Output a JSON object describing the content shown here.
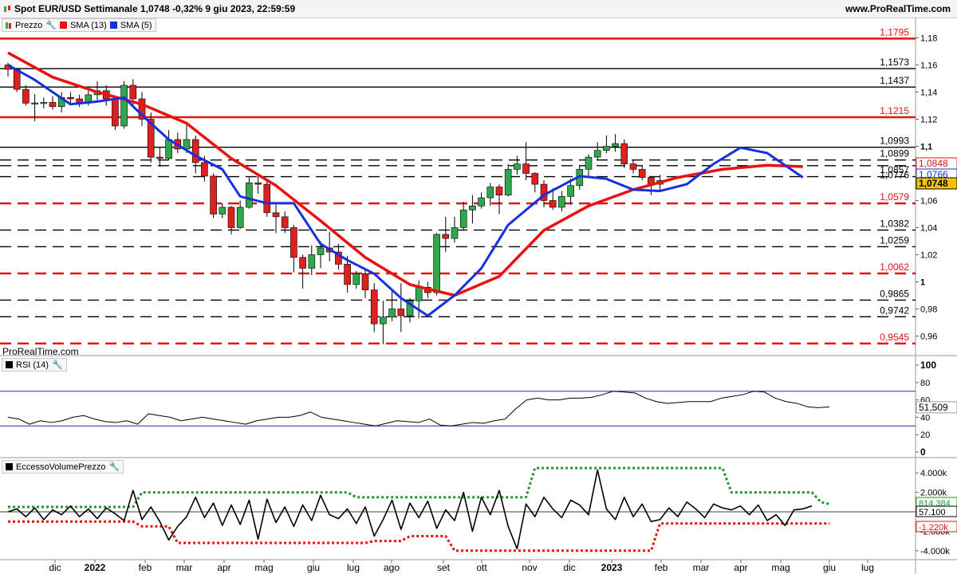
{
  "header": {
    "title": "Spot EUR/USD Settimanale 1,0748 -0,32% 9 giu 2023, 22:59:59",
    "site": "www.ProRealTime.com"
  },
  "watermark": "ProRealTime.com",
  "legend": {
    "price": "Prezzo",
    "sma13": "SMA (13)",
    "sma5": "SMA (5)",
    "rsi": "RSI (14)",
    "volume": "EccessoVolumePrezzo"
  },
  "colors": {
    "up": "#2ea84a",
    "down": "#e0201f",
    "sma13": "#e8120f",
    "sma5": "#1530e0",
    "levelRed": "#e8120f",
    "vpUpper": "#1f9a2a",
    "vpLower": "#e8120f"
  },
  "chart_data": [
    {
      "type": "candlestick",
      "x_labels": [
        "dic",
        "2022",
        "feb",
        "mar",
        "apr",
        "mag",
        "giu",
        "lug",
        "ago",
        "set",
        "ott",
        "nov",
        "dic",
        "2023",
        "feb",
        "mar",
        "apr",
        "mag",
        "giu",
        "lug"
      ],
      "ylim": [
        0.95,
        1.18
      ],
      "y_ticks": [
        "1,18",
        "1,16",
        "1,14",
        "1,12",
        "1,1",
        "1,08",
        "1,06",
        "1,04",
        "1,02",
        "1",
        "0,98",
        "0,96"
      ],
      "levels": [
        {
          "value": 1.1795,
          "label": "1,1795",
          "color": "red",
          "style": "solid"
        },
        {
          "value": 1.1573,
          "label": "1,1573",
          "color": "black",
          "style": "solid"
        },
        {
          "value": 1.1437,
          "label": "1,1437",
          "color": "black",
          "style": "solid"
        },
        {
          "value": 1.1215,
          "label": "1,1215",
          "color": "red",
          "style": "solid"
        },
        {
          "value": 1.0993,
          "label": "1,0993",
          "color": "black",
          "style": "solid"
        },
        {
          "value": 1.0899,
          "label": "1,0899",
          "color": "black",
          "style": "dashed"
        },
        {
          "value": 1.0857,
          "label": "1,0857",
          "color": "black",
          "style": "dashed"
        },
        {
          "value": 1.0776,
          "label": "1,0776",
          "color": "black",
          "style": "dashed"
        },
        {
          "value": 1.0579,
          "label": "1,0579",
          "color": "red",
          "style": "dashed"
        },
        {
          "value": 1.0382,
          "label": "1,0382",
          "color": "black",
          "style": "dashed"
        },
        {
          "value": 1.0259,
          "label": "1,0259",
          "color": "black",
          "style": "dashed"
        },
        {
          "value": 1.0062,
          "label": "1,0062",
          "color": "red",
          "style": "dashed"
        },
        {
          "value": 0.9865,
          "label": "0,9865",
          "color": "black",
          "style": "dashed"
        },
        {
          "value": 0.9742,
          "label": "0,9742",
          "color": "black",
          "style": "dashed"
        },
        {
          "value": 0.9545,
          "label": "0,9545",
          "color": "red",
          "style": "dashed"
        }
      ],
      "price_tags": [
        {
          "value": 1.0848,
          "label": "1,0848",
          "color": "red"
        },
        {
          "value": 1.0766,
          "label": "1,0766",
          "color": "blue"
        },
        {
          "value": 1.0748,
          "label": "1,0748",
          "color": "gold"
        }
      ],
      "candles": [
        [
          1.16,
          1.1568,
          1.1617,
          1.1514
        ],
        [
          1.1568,
          1.142,
          1.1579,
          1.14
        ],
        [
          1.142,
          1.1318,
          1.145,
          1.13
        ],
        [
          1.1318,
          1.132,
          1.1385,
          1.1184
        ],
        [
          1.132,
          1.1324,
          1.136,
          1.128
        ],
        [
          1.1324,
          1.1293,
          1.137,
          1.127
        ],
        [
          1.1293,
          1.136,
          1.14,
          1.125
        ],
        [
          1.136,
          1.135,
          1.14,
          1.131
        ],
        [
          1.135,
          1.132,
          1.138,
          1.129
        ],
        [
          1.132,
          1.138,
          1.141,
          1.13
        ],
        [
          1.138,
          1.141,
          1.148,
          1.134
        ],
        [
          1.141,
          1.135,
          1.145,
          1.13
        ],
        [
          1.135,
          1.115,
          1.137,
          1.112
        ],
        [
          1.115,
          1.145,
          1.1482,
          1.113
        ],
        [
          1.145,
          1.135,
          1.1495,
          1.13
        ],
        [
          1.135,
          1.12,
          1.14,
          1.115
        ],
        [
          1.12,
          1.092,
          1.125,
          1.088
        ],
        [
          1.092,
          1.091,
          1.099,
          1.085
        ],
        [
          1.091,
          1.105,
          1.112,
          1.09
        ],
        [
          1.105,
          1.098,
          1.11,
          1.095
        ],
        [
          1.098,
          1.105,
          1.118,
          1.095
        ],
        [
          1.105,
          1.088,
          1.108,
          1.08
        ],
        [
          1.088,
          1.078,
          1.093,
          1.074
        ],
        [
          1.078,
          1.05,
          1.08,
          1.047
        ],
        [
          1.05,
          1.055,
          1.058,
          1.047
        ],
        [
          1.055,
          1.04,
          1.056,
          1.035
        ],
        [
          1.04,
          1.055,
          1.06,
          1.039
        ],
        [
          1.055,
          1.073,
          1.077,
          1.054
        ],
        [
          1.073,
          1.072,
          1.078,
          1.065
        ],
        [
          1.072,
          1.051,
          1.076,
          1.048
        ],
        [
          1.051,
          1.048,
          1.057,
          1.036
        ],
        [
          1.048,
          1.04,
          1.052,
          1.036
        ],
        [
          1.04,
          1.018,
          1.042,
          1.007
        ],
        [
          1.018,
          1.01,
          1.02,
          0.995
        ],
        [
          1.01,
          1.02,
          1.027,
          1.005
        ],
        [
          1.02,
          1.025,
          1.03,
          1.01
        ],
        [
          1.025,
          1.022,
          1.037,
          1.015
        ],
        [
          1.022,
          1.013,
          1.028,
          1.009
        ],
        [
          1.013,
          0.998,
          1.019,
          0.992
        ],
        [
          0.998,
          1.006,
          1.008,
          0.995
        ],
        [
          1.006,
          0.994,
          1.01,
          0.988
        ],
        [
          0.994,
          0.969,
          0.999,
          0.963
        ],
        [
          0.969,
          0.974,
          0.986,
          0.954
        ],
        [
          0.974,
          0.98,
          0.993,
          0.971
        ],
        [
          0.98,
          0.975,
          0.999,
          0.963
        ],
        [
          0.975,
          0.986,
          0.988,
          0.97
        ],
        [
          0.986,
          0.996,
          1.001,
          0.973
        ],
        [
          0.996,
          0.992,
          1.0,
          0.988
        ],
        [
          0.992,
          1.035,
          1.036,
          0.99
        ],
        [
          1.035,
          1.032,
          1.048,
          1.022
        ],
        [
          1.032,
          1.04,
          1.048,
          1.029
        ],
        [
          1.04,
          1.053,
          1.059,
          1.038
        ],
        [
          1.053,
          1.056,
          1.064,
          1.043
        ],
        [
          1.056,
          1.062,
          1.066,
          1.054
        ],
        [
          1.062,
          1.07,
          1.073,
          1.056
        ],
        [
          1.07,
          1.064,
          1.072,
          1.05
        ],
        [
          1.064,
          1.083,
          1.087,
          1.063
        ],
        [
          1.083,
          1.087,
          1.093,
          1.079
        ],
        [
          1.087,
          1.08,
          1.103,
          1.075
        ],
        [
          1.08,
          1.072,
          1.081,
          1.066
        ],
        [
          1.072,
          1.06,
          1.075,
          1.055
        ],
        [
          1.06,
          1.055,
          1.069,
          1.053
        ],
        [
          1.055,
          1.063,
          1.067,
          1.052
        ],
        [
          1.063,
          1.071,
          1.076,
          1.057
        ],
        [
          1.071,
          1.083,
          1.086,
          1.068
        ],
        [
          1.083,
          1.092,
          1.094,
          1.078
        ],
        [
          1.092,
          1.097,
          1.103,
          1.09
        ],
        [
          1.097,
          1.1,
          1.108,
          1.095
        ],
        [
          1.1,
          1.102,
          1.109,
          1.096
        ],
        [
          1.102,
          1.087,
          1.105,
          1.084
        ],
        [
          1.087,
          1.083,
          1.09,
          1.08
        ],
        [
          1.083,
          1.077,
          1.086,
          1.075
        ],
        [
          1.077,
          1.072,
          1.078,
          1.064
        ],
        [
          1.072,
          1.0748,
          1.079,
          1.067
        ]
      ],
      "sma13": [
        [
          0,
          1.169
        ],
        [
          5,
          1.151
        ],
        [
          10,
          1.14
        ],
        [
          15,
          1.131
        ],
        [
          20,
          1.117
        ],
        [
          25,
          1.091
        ],
        [
          30,
          1.071
        ],
        [
          35,
          1.045
        ],
        [
          40,
          1.018
        ],
        [
          45,
          0.998
        ],
        [
          50,
          0.99
        ],
        [
          55,
          1.004
        ],
        [
          60,
          1.038
        ],
        [
          65,
          1.056
        ],
        [
          70,
          1.068
        ],
        [
          75,
          1.077
        ],
        [
          80,
          1.083
        ],
        [
          85,
          1.086
        ],
        [
          89,
          1.085
        ]
      ],
      "sma5": [
        [
          0,
          1.16
        ],
        [
          3,
          1.149
        ],
        [
          7,
          1.131
        ],
        [
          10,
          1.133
        ],
        [
          13,
          1.136
        ],
        [
          15,
          1.123
        ],
        [
          18,
          1.105
        ],
        [
          21,
          1.093
        ],
        [
          24,
          1.083
        ],
        [
          26,
          1.063
        ],
        [
          29,
          1.058
        ],
        [
          32,
          1.058
        ],
        [
          35,
          1.028
        ],
        [
          38,
          1.016
        ],
        [
          41,
          1.006
        ],
        [
          44,
          0.988
        ],
        [
          47,
          0.975
        ],
        [
          50,
          0.99
        ],
        [
          53,
          1.01
        ],
        [
          56,
          1.042
        ],
        [
          60,
          1.064
        ],
        [
          64,
          1.078
        ],
        [
          67,
          1.076
        ],
        [
          70,
          1.068
        ],
        [
          73,
          1.067
        ],
        [
          76,
          1.072
        ],
        [
          79,
          1.087
        ],
        [
          82,
          1.099
        ],
        [
          85,
          1.095
        ],
        [
          89,
          1.077
        ]
      ]
    },
    {
      "type": "line",
      "name": "RSI (14)",
      "ylim": [
        0,
        100
      ],
      "y_ticks": [
        "100",
        "80",
        "60",
        "40",
        "20",
        "0"
      ],
      "bands": [
        70,
        30
      ],
      "last_label": "51,509",
      "values": [
        40,
        38,
        32,
        36,
        34,
        36,
        40,
        42,
        38,
        35,
        34,
        36,
        32,
        44,
        42,
        40,
        36,
        38,
        40,
        38,
        36,
        34,
        32,
        36,
        38,
        40,
        40,
        42,
        46,
        40,
        38,
        36,
        34,
        32,
        30,
        33,
        36,
        35,
        34,
        38,
        31,
        30,
        32,
        34,
        33,
        36,
        38,
        50,
        60,
        62,
        60,
        60,
        62,
        62,
        63,
        66,
        70,
        69,
        68,
        62,
        58,
        56,
        57,
        58,
        58,
        58,
        62,
        64,
        66,
        70,
        69,
        62,
        58,
        56,
        52,
        51,
        52
      ]
    },
    {
      "type": "line",
      "name": "EccessoVolumePrezzo",
      "ylim": [
        -5000,
        5000
      ],
      "y_ticks": [
        "4.000k",
        "2.000k",
        "-2.000k",
        "-4.000k"
      ],
      "tags": [
        {
          "label": "814.384",
          "color": "green"
        },
        {
          "label": "57.100",
          "color": "black"
        },
        {
          "label": "-1.220k",
          "color": "red"
        }
      ],
      "upper": [
        [
          0,
          500
        ],
        [
          14,
          500
        ],
        [
          15,
          2000
        ],
        [
          38,
          2000
        ],
        [
          39,
          1500
        ],
        [
          58,
          1500
        ],
        [
          59,
          4500
        ],
        [
          80,
          4500
        ],
        [
          81,
          2000
        ],
        [
          90,
          2000
        ],
        [
          91,
          1000
        ],
        [
          92,
          800
        ]
      ],
      "lower": [
        [
          0,
          -1000
        ],
        [
          14,
          -1000
        ],
        [
          15,
          -1500
        ],
        [
          18,
          -1500
        ],
        [
          19,
          -3200
        ],
        [
          40,
          -3200
        ],
        [
          41,
          -3000
        ],
        [
          44,
          -3000
        ],
        [
          45,
          -2500
        ],
        [
          49,
          -2500
        ],
        [
          50,
          -4000
        ],
        [
          72,
          -4000
        ],
        [
          73,
          -1200
        ],
        [
          92,
          -1200
        ]
      ],
      "values": [
        0,
        300,
        -500,
        400,
        -800,
        200,
        -300,
        600,
        -500,
        300,
        -700,
        400,
        -200,
        -900,
        2200,
        -800,
        500,
        -1000,
        -2900,
        -1500,
        -500,
        1500,
        -600,
        900,
        -1400,
        700,
        -1300,
        1200,
        -2800,
        1300,
        -1100,
        500,
        -1500,
        700,
        -900,
        1700,
        -300,
        -700,
        300,
        -1200,
        500,
        -2500,
        -800,
        1200,
        -1800,
        900,
        -600,
        1100,
        -1700,
        200,
        -900,
        2000,
        -2000,
        1500,
        -300,
        2200,
        -1500,
        -3800,
        800,
        -500,
        1500,
        300,
        -600,
        1200,
        700,
        -300,
        4300,
        300,
        -800,
        1500,
        -500,
        800,
        -1000,
        -800,
        400,
        -500,
        1000,
        300,
        -600,
        800,
        400,
        200,
        600,
        -300,
        700,
        -900,
        -300,
        -1400,
        200,
        300,
        600
      ]
    }
  ]
}
